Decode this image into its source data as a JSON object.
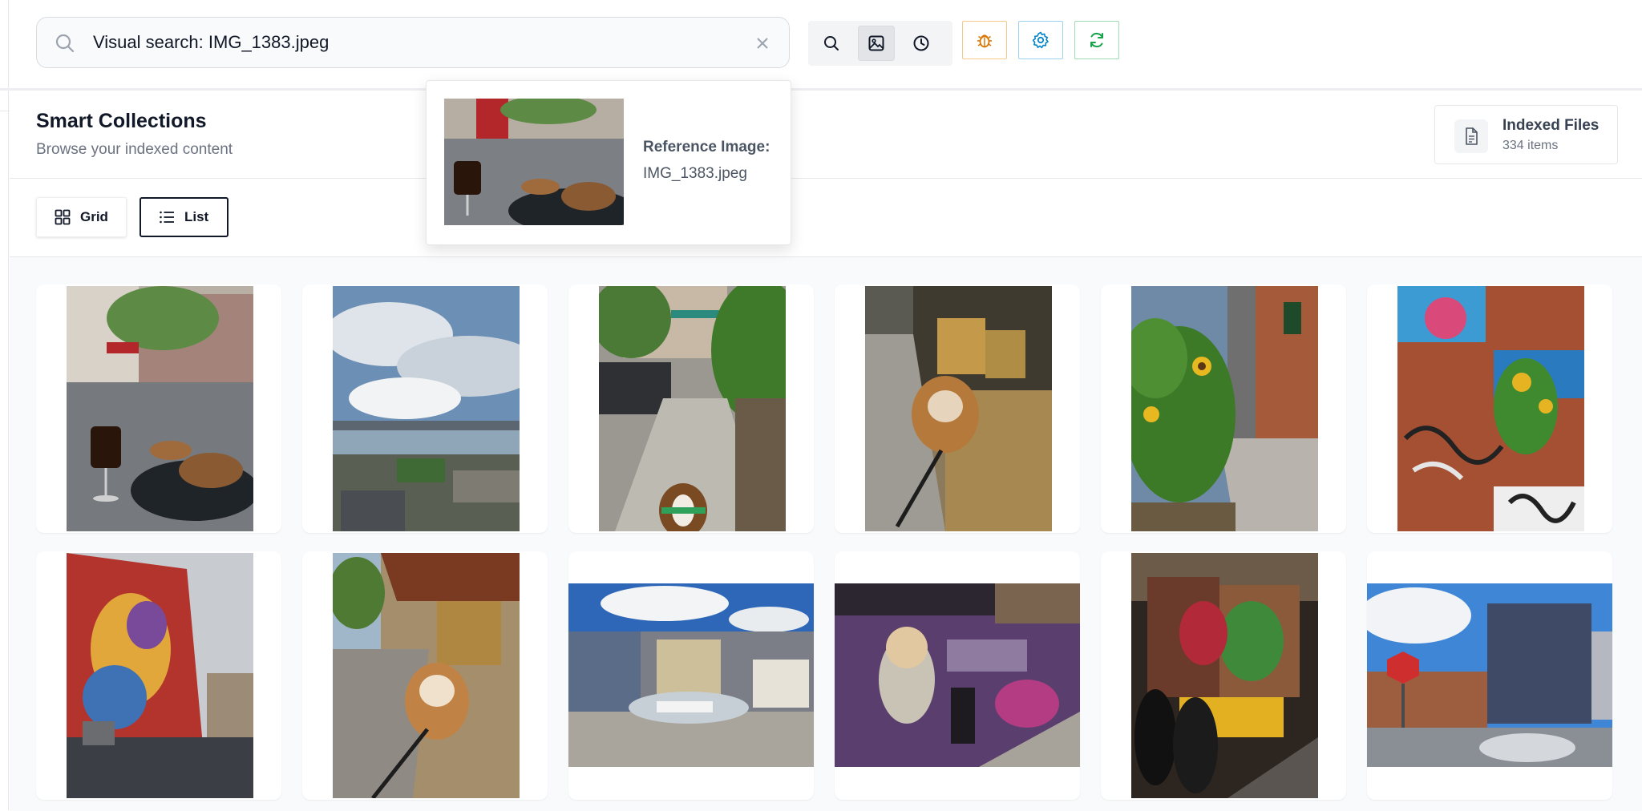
{
  "search": {
    "value": "Visual search: IMG_1383.jpeg",
    "placeholder": "",
    "icons": [
      "search-icon",
      "close-icon"
    ]
  },
  "toolbar": {
    "group": [
      {
        "name": "search-mode-button",
        "icon": "search-icon"
      },
      {
        "name": "image-search-button",
        "icon": "image-icon",
        "active": true
      },
      {
        "name": "history-button",
        "icon": "clock-icon"
      }
    ],
    "actions": [
      {
        "name": "debug-button",
        "icon": "bug-icon",
        "color": "#d97706"
      },
      {
        "name": "settings-button",
        "icon": "gear-icon",
        "color": "#0284c7"
      },
      {
        "name": "refresh-button",
        "icon": "refresh-icon",
        "color": "#16a34a"
      }
    ]
  },
  "popup": {
    "label": "Reference Image:",
    "filename": "IMG_1383.jpeg"
  },
  "collections": {
    "title": "Smart Collections",
    "subtitle": "Browse your indexed content"
  },
  "indexed": {
    "title": "Indexed Files",
    "count": "334 items"
  },
  "view": {
    "grid_label": "Grid",
    "list_label": "List",
    "active": "list"
  },
  "results": [
    {
      "scene": "cafe table with espresso drink and pastries on wet street",
      "orientation": "portrait"
    },
    {
      "scene": "cloudy sky over river and city skyline",
      "orientation": "portrait"
    },
    {
      "scene": "courtyard patio with dog in foreground",
      "orientation": "portrait"
    },
    {
      "scene": "bulldog on leash by outdoor cafe chairs",
      "orientation": "portrait"
    },
    {
      "scene": "sunflowers by brick building",
      "orientation": "portrait"
    },
    {
      "scene": "sunflower against graffiti brick wall",
      "orientation": "portrait"
    },
    {
      "scene": "large colorful mural on building",
      "orientation": "portrait"
    },
    {
      "scene": "bulldog on leash under awning",
      "orientation": "portrait"
    },
    {
      "scene": "art car on street",
      "orientation": "landscape"
    },
    {
      "scene": "graffiti mural of astronaut",
      "orientation": "landscape"
    },
    {
      "scene": "night street with mural and taxi",
      "orientation": "portrait"
    },
    {
      "scene": "street with stop sign and mural",
      "orientation": "landscape"
    }
  ],
  "colors": {
    "accent": "#111827",
    "debug": "#d97706",
    "settings": "#0284c7",
    "refresh": "#16a34a"
  }
}
